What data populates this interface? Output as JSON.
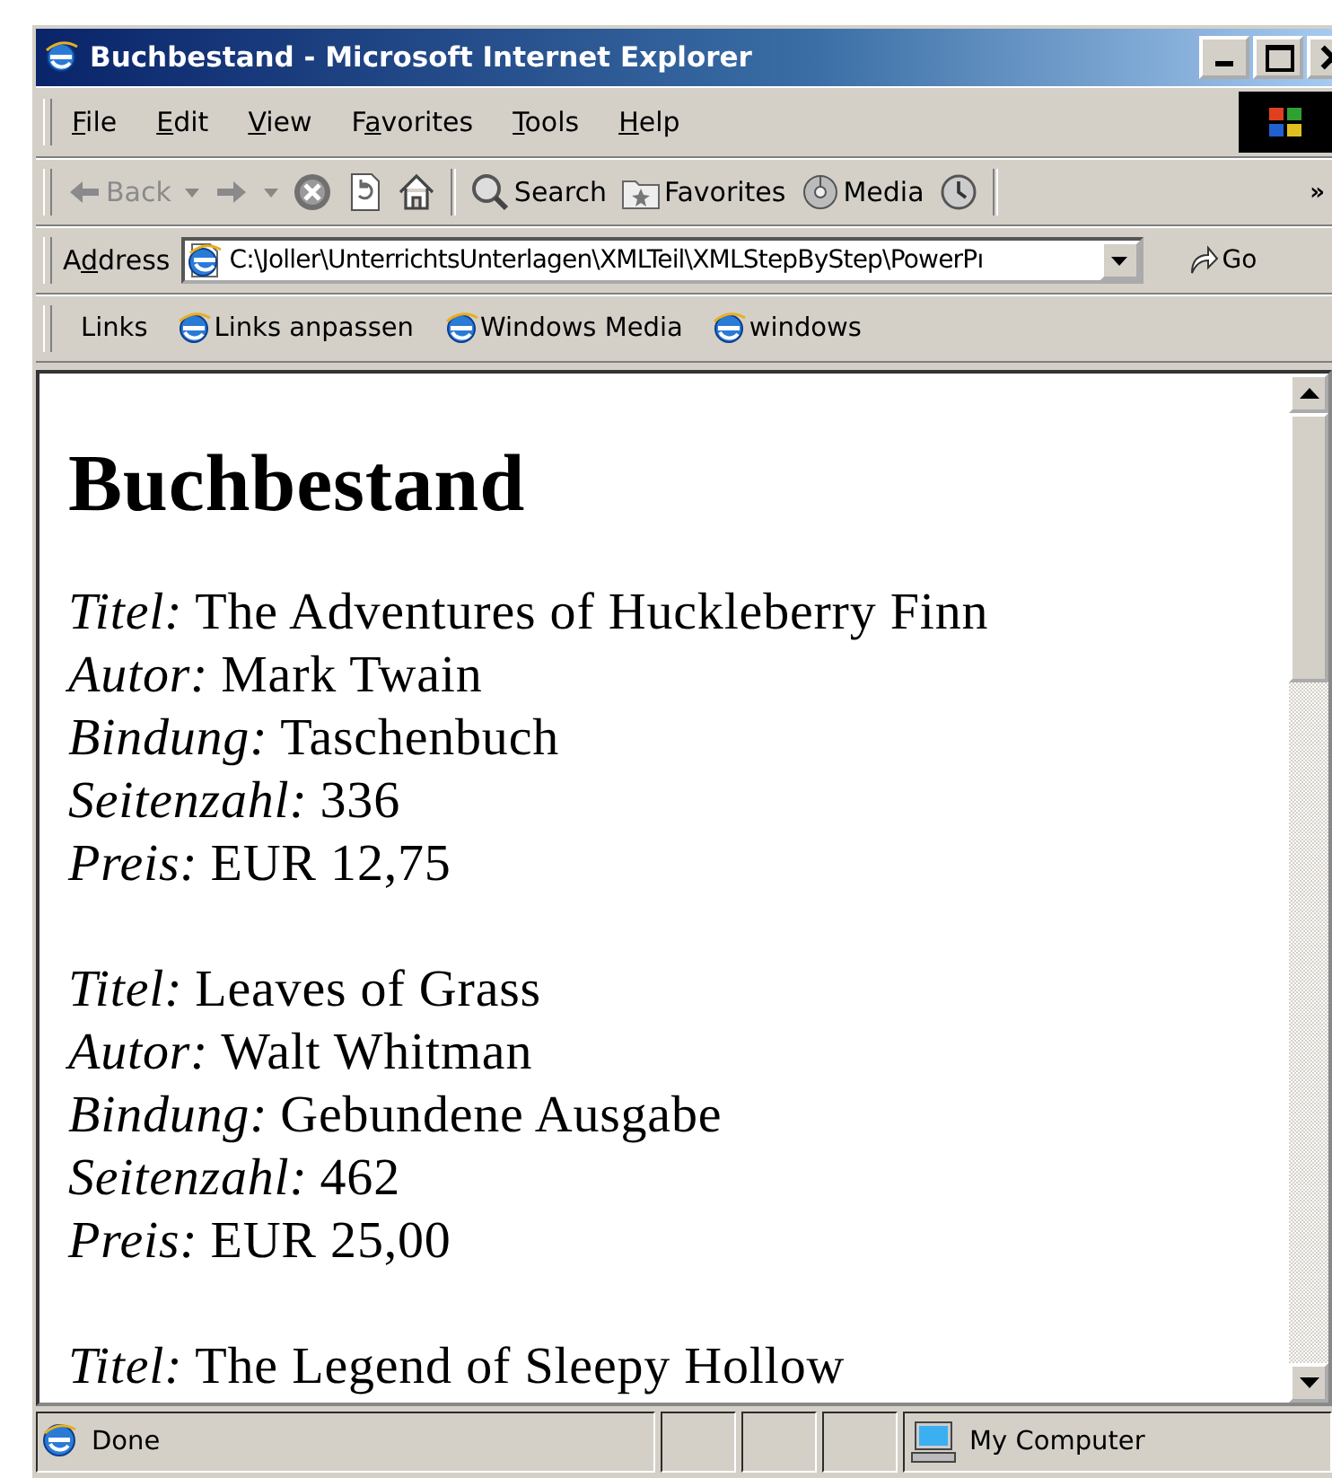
{
  "window": {
    "title": "Buchbestand - Microsoft Internet Explorer"
  },
  "menu": [
    {
      "key": "F",
      "post": "ile"
    },
    {
      "key": "E",
      "post": "dit"
    },
    {
      "key": "V",
      "post": "iew"
    },
    {
      "pre": "F",
      "key": "a",
      "post": "vorites"
    },
    {
      "key": "T",
      "post": "ools"
    },
    {
      "key": "H",
      "post": "elp"
    }
  ],
  "toolbar": [
    {
      "kind": "back",
      "label": "Back",
      "disabled": true
    },
    {
      "kind": "forward",
      "disabled": true
    },
    {
      "kind": "stop"
    },
    {
      "kind": "refresh"
    },
    {
      "kind": "home"
    },
    {
      "kind": "separator"
    },
    {
      "kind": "search",
      "label": "Search"
    },
    {
      "kind": "favorites",
      "label": "Favorites"
    },
    {
      "kind": "media",
      "label": "Media"
    },
    {
      "kind": "history"
    },
    {
      "kind": "separator"
    },
    {
      "kind": "more",
      "label": "»"
    }
  ],
  "address": {
    "label": {
      "pre": "A",
      "key": "d",
      "post": "dress"
    },
    "value": "C:\\Joller\\UnterrichtsUnterlagen\\XMLTeil\\XMLStepByStep\\PowerPı",
    "go": "Go"
  },
  "links": {
    "label": "Links",
    "items": [
      "Links anpassen",
      "Windows Media",
      "windows"
    ]
  },
  "content": {
    "heading": "Buchbestand",
    "books": [
      {
        "fields": [
          {
            "label": "Titel:",
            "value": "The Adventures of Huckleberry Finn"
          },
          {
            "label": "Autor:",
            "value": "Mark Twain"
          },
          {
            "label": "Bindung:",
            "value": "Taschenbuch"
          },
          {
            "label": "Seitenzahl:",
            "value": "336"
          },
          {
            "label": "Preis:",
            "value": "EUR 12,75"
          }
        ]
      },
      {
        "fields": [
          {
            "label": "Titel:",
            "value": "Leaves of Grass"
          },
          {
            "label": "Autor:",
            "value": "Walt Whitman"
          },
          {
            "label": "Bindung:",
            "value": "Gebundene Ausgabe"
          },
          {
            "label": "Seitenzahl:",
            "value": "462"
          },
          {
            "label": "Preis:",
            "value": "EUR 25,00"
          }
        ]
      },
      {
        "fields": [
          {
            "label": "Titel:",
            "value": "The Legend of Sleepy Hollow"
          }
        ]
      }
    ]
  },
  "status_bar": {
    "text": "Done",
    "zone": "My Computer"
  }
}
